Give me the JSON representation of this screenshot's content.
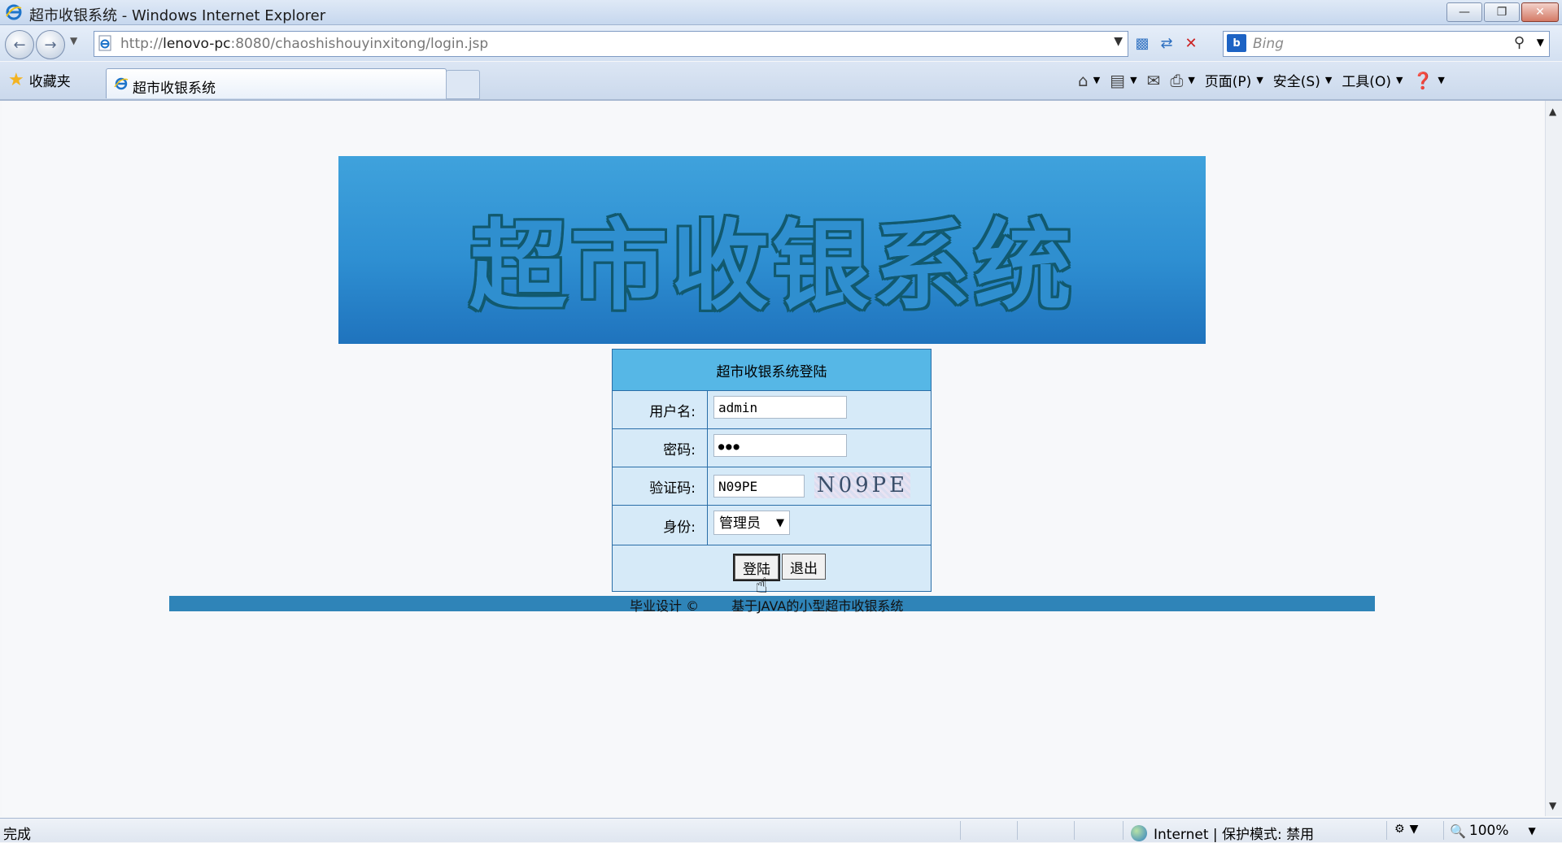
{
  "window": {
    "title": "超市收银系统 - Windows Internet Explorer",
    "buttons": {
      "minimize": "—",
      "restore": "❐",
      "close": "✕"
    }
  },
  "address_bar": {
    "url_prefix": "http://",
    "url_host": "lenovo-pc",
    "url_rest": ":8080/chaoshishouyinxitong/login.jsp",
    "search_placeholder": "Bing",
    "search_badge": "b"
  },
  "toolbar": {
    "favorites_label": "收藏夹",
    "tab_label": "超市收银系统",
    "page_menu": "页面(P)",
    "safety_menu": "安全(S)",
    "tools_menu": "工具(O)"
  },
  "page": {
    "banner_title": "超市收银系统",
    "login": {
      "header": "超市收银系统登陆",
      "username_label": "用户名:",
      "username_value": "admin",
      "password_label": "密码:",
      "password_value": "●●●",
      "captcha_label": "验证码:",
      "captcha_input": "N09PE",
      "captcha_image_text": "N09PE",
      "role_label": "身份:",
      "role_value": "管理员",
      "login_button": "登陆",
      "exit_button": "退出"
    },
    "footer": {
      "left": "毕业设计 ©",
      "right": "基于JAVA的小型超市收银系统"
    }
  },
  "status_bar": {
    "left_text": "完成",
    "zone_text": "Internet | 保护模式: 禁用",
    "zoom": "100%"
  },
  "colors": {
    "banner_top": "#3fa2dc",
    "banner_bottom": "#1f73bd",
    "form_header": "#56b7e6",
    "form_body": "#d6eaf8",
    "footer_bar": "#2f84b8"
  }
}
